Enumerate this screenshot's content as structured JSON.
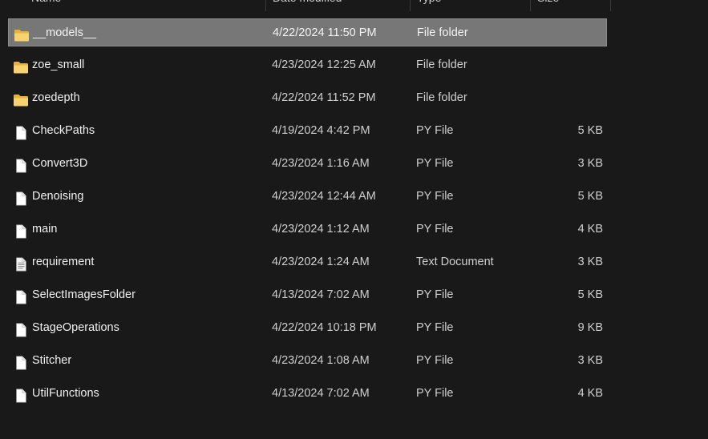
{
  "columns": {
    "name": "Name",
    "date_modified": "Date modified",
    "type": "Type",
    "size": "Size"
  },
  "colors": {
    "background": "#191919",
    "selection": "#777777",
    "folder": "#f2c14e"
  },
  "files": [
    {
      "name": "__models__",
      "date": "4/22/2024 11:50 PM",
      "type": "File folder",
      "size": "",
      "icon": "folder-icon",
      "selected": true
    },
    {
      "name": "zoe_small",
      "date": "4/23/2024 12:25 AM",
      "type": "File folder",
      "size": "",
      "icon": "folder-icon",
      "selected": false
    },
    {
      "name": "zoedepth",
      "date": "4/22/2024 11:52 PM",
      "type": "File folder",
      "size": "",
      "icon": "folder-icon",
      "selected": false
    },
    {
      "name": "CheckPaths",
      "date": "4/19/2024 4:42 PM",
      "type": "PY File",
      "size": "5 KB",
      "icon": "file-icon",
      "selected": false
    },
    {
      "name": "Convert3D",
      "date": "4/23/2024 1:16 AM",
      "type": "PY File",
      "size": "3 KB",
      "icon": "file-icon",
      "selected": false
    },
    {
      "name": "Denoising",
      "date": "4/23/2024 12:44 AM",
      "type": "PY File",
      "size": "5 KB",
      "icon": "file-icon",
      "selected": false
    },
    {
      "name": "main",
      "date": "4/23/2024 1:12 AM",
      "type": "PY File",
      "size": "4 KB",
      "icon": "file-icon",
      "selected": false
    },
    {
      "name": "requirement",
      "date": "4/23/2024 1:24 AM",
      "type": "Text Document",
      "size": "3 KB",
      "icon": "text-document-icon",
      "selected": false
    },
    {
      "name": "SelectImagesFolder",
      "date": "4/13/2024 7:02 AM",
      "type": "PY File",
      "size": "5 KB",
      "icon": "file-icon",
      "selected": false
    },
    {
      "name": "StageOperations",
      "date": "4/22/2024 10:18 PM",
      "type": "PY File",
      "size": "9 KB",
      "icon": "file-icon",
      "selected": false
    },
    {
      "name": "Stitcher",
      "date": "4/23/2024 1:08 AM",
      "type": "PY File",
      "size": "3 KB",
      "icon": "file-icon",
      "selected": false
    },
    {
      "name": "UtilFunctions",
      "date": "4/13/2024 7:02 AM",
      "type": "PY File",
      "size": "4 KB",
      "icon": "file-icon",
      "selected": false
    }
  ]
}
